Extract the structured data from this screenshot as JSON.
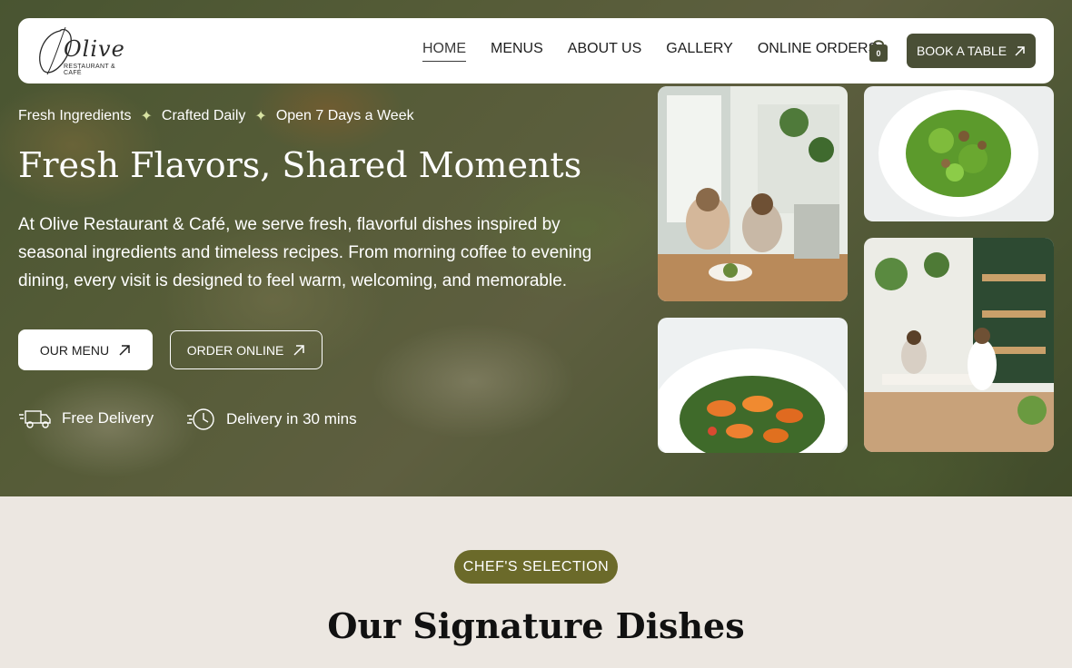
{
  "brand": {
    "logo_word": "Olive",
    "logo_sub": "RESTAURANT & CAFÉ"
  },
  "nav": {
    "items": [
      {
        "label": "HOME",
        "active": true
      },
      {
        "label": "MENUS",
        "active": false
      },
      {
        "label": "ABOUT US",
        "active": false
      },
      {
        "label": "GALLERY",
        "active": false
      },
      {
        "label": "ONLINE ORDERS",
        "active": false
      }
    ],
    "cart_count": "0",
    "book_label": "BOOK A TABLE"
  },
  "hero": {
    "tagline": [
      "Fresh Ingredients",
      "Crafted Daily",
      "Open 7 Days a Week"
    ],
    "title": "Fresh Flavors, Shared Moments",
    "description": "At Olive Restaurant & Café, we serve fresh, flavorful dishes inspired by seasonal ingredients and timeless recipes. From morning coffee to evening dining, every visit is designed to feel warm, welcoming, and memorable.",
    "buttons": {
      "menu": "OUR MENU",
      "order": "ORDER ONLINE"
    },
    "features": {
      "delivery": "Free Delivery",
      "time": "Delivery in 30 mins"
    }
  },
  "gallery": {
    "photos": [
      {
        "icon": "dining-room-photo"
      },
      {
        "icon": "salad-photo"
      },
      {
        "icon": "shrimp-dish-photo"
      },
      {
        "icon": "restaurant-interior-photo"
      }
    ]
  },
  "section": {
    "badge": "CHEF'S SELECTION",
    "title": "Our Signature Dishes"
  },
  "colors": {
    "accent_dark": "#4a4f36",
    "badge_olive": "#6b6a2a",
    "section_bg": "#ece7e1",
    "spark": "#d8e3a2"
  }
}
